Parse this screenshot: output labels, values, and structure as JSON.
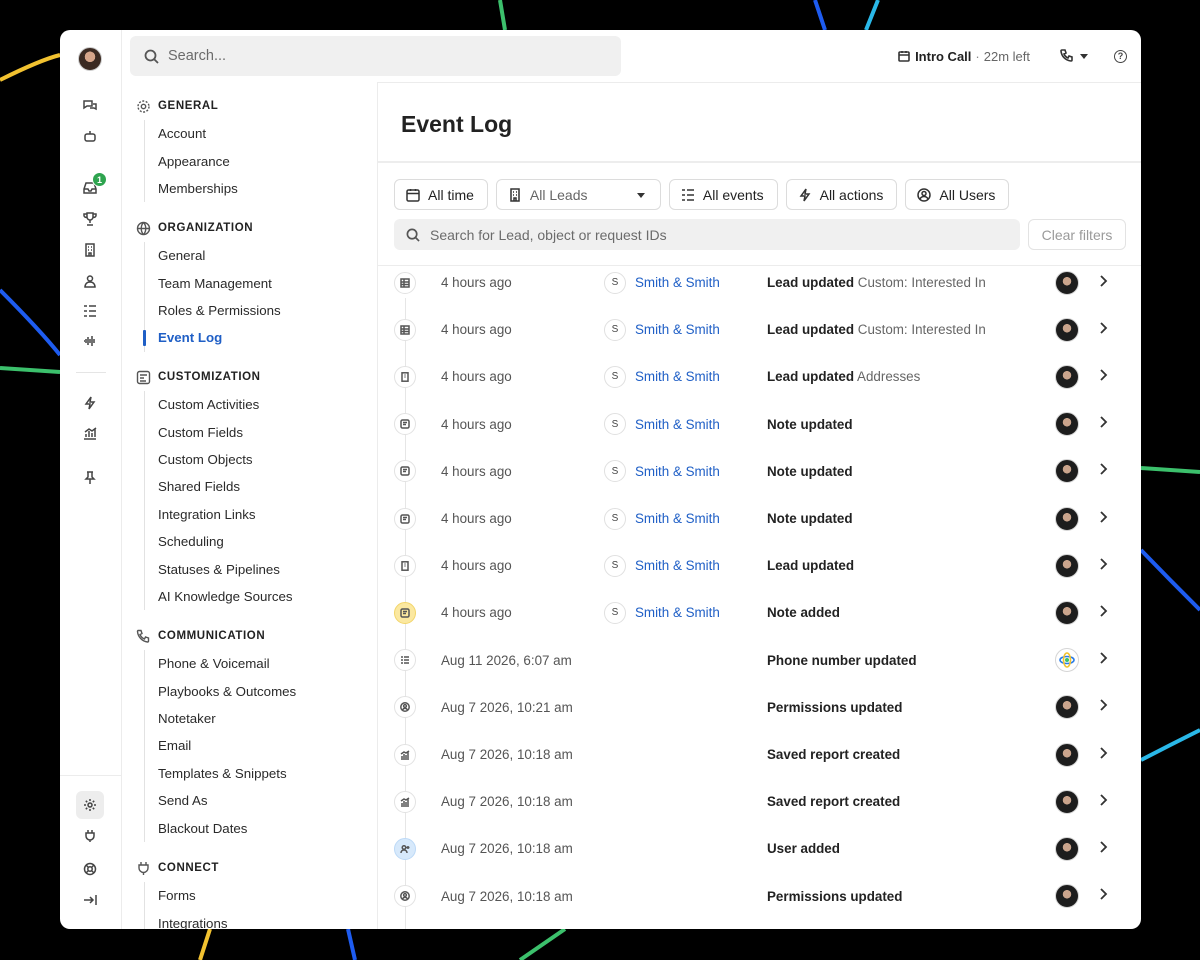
{
  "search": {
    "placeholder": "Search..."
  },
  "topbar": {
    "call_title": "Intro Call",
    "call_separator": "·",
    "call_time_left": "22m left",
    "help_glyph": "?"
  },
  "rail": {
    "badge_count": "1",
    "icons": [
      "chat-icon",
      "bot-icon",
      "inbox-icon",
      "trophy-icon",
      "building-icon",
      "person-icon",
      "list-icon",
      "waveform-icon",
      "lightning-icon",
      "chart-icon",
      "pin-icon",
      "gear-icon",
      "plug-icon",
      "support-icon",
      "collapse-icon"
    ]
  },
  "nav": {
    "general": {
      "title": "GENERAL",
      "items": [
        "Account",
        "Appearance",
        "Memberships"
      ]
    },
    "organization": {
      "title": "ORGANIZATION",
      "items": [
        "General",
        "Team Management",
        "Roles & Permissions",
        "Event Log"
      ]
    },
    "customization": {
      "title": "CUSTOMIZATION",
      "items": [
        "Custom Activities",
        "Custom Fields",
        "Custom Objects",
        "Shared Fields",
        "Integration Links",
        "Scheduling",
        "Statuses & Pipelines",
        "AI Knowledge Sources"
      ]
    },
    "communication": {
      "title": "COMMUNICATION",
      "items": [
        "Phone & Voicemail",
        "Playbooks & Outcomes",
        "Notetaker",
        "Email",
        "Templates & Snippets",
        "Send As",
        "Blackout Dates"
      ]
    },
    "connect": {
      "title": "CONNECT",
      "items": [
        "Forms",
        "Integrations"
      ]
    },
    "active_item": "Event Log"
  },
  "main": {
    "title": "Event Log",
    "filters": {
      "time": "All time",
      "leads": "All Leads",
      "events": "All events",
      "actions": "All actions",
      "users": "All Users"
    },
    "id_search_placeholder": "Search for Lead, object or request IDs",
    "clear_filters": "Clear filters"
  },
  "events": [
    {
      "icon": "table-icon",
      "style": "plain",
      "time": "4 hours ago",
      "lead_initial": "S",
      "lead": "Smith & Smith",
      "action": "Lead updated",
      "detail": "Custom: Interested In",
      "user": "user-avatar"
    },
    {
      "icon": "table-icon",
      "style": "plain",
      "time": "4 hours ago",
      "lead_initial": "S",
      "lead": "Smith & Smith",
      "action": "Lead updated",
      "detail": "Custom: Interested In",
      "user": "user-avatar"
    },
    {
      "icon": "building-icon",
      "style": "plain",
      "time": "4 hours ago",
      "lead_initial": "S",
      "lead": "Smith & Smith",
      "action": "Lead updated",
      "detail": "Addresses",
      "user": "user-avatar"
    },
    {
      "icon": "note-icon",
      "style": "plain",
      "time": "4 hours ago",
      "lead_initial": "S",
      "lead": "Smith & Smith",
      "action": "Note updated",
      "detail": "",
      "user": "user-avatar"
    },
    {
      "icon": "note-icon",
      "style": "plain",
      "time": "4 hours ago",
      "lead_initial": "S",
      "lead": "Smith & Smith",
      "action": "Note updated",
      "detail": "",
      "user": "user-avatar"
    },
    {
      "icon": "note-icon",
      "style": "plain",
      "time": "4 hours ago",
      "lead_initial": "S",
      "lead": "Smith & Smith",
      "action": "Note updated",
      "detail": "",
      "user": "user-avatar"
    },
    {
      "icon": "building-icon",
      "style": "plain",
      "time": "4 hours ago",
      "lead_initial": "S",
      "lead": "Smith & Smith",
      "action": "Lead updated",
      "detail": "",
      "user": "user-avatar"
    },
    {
      "icon": "note-icon",
      "style": "yellow",
      "time": "4 hours ago",
      "lead_initial": "S",
      "lead": "Smith & Smith",
      "action": "Note added",
      "detail": "",
      "user": "user-avatar"
    },
    {
      "icon": "list-icon",
      "style": "plain",
      "time": "Aug 11 2026, 6:07 am",
      "lead_initial": "",
      "lead": "",
      "action": "Phone number updated",
      "detail": "",
      "user": "integration-logo"
    },
    {
      "icon": "person-icon",
      "style": "plain",
      "time": "Aug 7 2026, 10:21 am",
      "lead_initial": "",
      "lead": "",
      "action": "Permissions updated",
      "detail": "",
      "user": "user-avatar"
    },
    {
      "icon": "chart-icon",
      "style": "plain",
      "time": "Aug 7 2026, 10:18 am",
      "lead_initial": "",
      "lead": "",
      "action": "Saved report created",
      "detail": "",
      "user": "user-avatar"
    },
    {
      "icon": "chart-icon",
      "style": "plain",
      "time": "Aug 7 2026, 10:18 am",
      "lead_initial": "",
      "lead": "",
      "action": "Saved report created",
      "detail": "",
      "user": "user-avatar"
    },
    {
      "icon": "user-plus-icon",
      "style": "blue",
      "time": "Aug 7 2026, 10:18 am",
      "lead_initial": "",
      "lead": "",
      "action": "User added",
      "detail": "",
      "user": "user-avatar"
    },
    {
      "icon": "person-icon",
      "style": "plain",
      "time": "Aug 7 2026, 10:18 am",
      "lead_initial": "",
      "lead": "",
      "action": "Permissions updated",
      "detail": "",
      "user": "user-avatar"
    }
  ],
  "colors": {
    "link": "#1f5fc6",
    "badge": "#2ea44f",
    "background": "#000000"
  }
}
